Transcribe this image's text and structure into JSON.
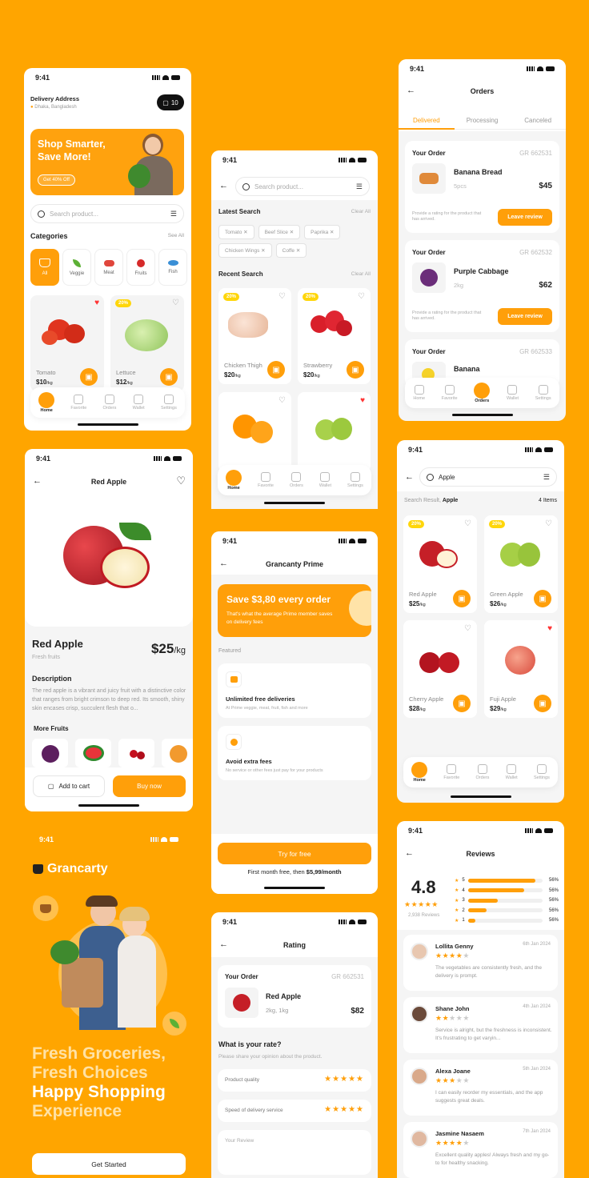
{
  "status_time": "9:41",
  "home": {
    "delivery_label": "Delivery Address",
    "delivery_location": "Dhaka, Bangladesh",
    "cart_count": "10",
    "banner_title_1": "Shop Smarter,",
    "banner_title_2": "Save More!",
    "banner_button": "Get 40% Off",
    "search_placeholder": "Search product...",
    "categories_title": "Categories",
    "see_all": "See All",
    "categories": [
      "All",
      "Veggie",
      "Meat",
      "Fruits",
      "Fish"
    ],
    "products": [
      {
        "name": "Tomato",
        "price": "$10",
        "unit": "/kg"
      },
      {
        "name": "Lettuce",
        "price": "$12",
        "unit": "/kg",
        "badge": "20%"
      }
    ]
  },
  "tabs": [
    "Home",
    "Favorite",
    "Orders",
    "Wallet",
    "Settings"
  ],
  "search_screen": {
    "placeholder": "Search product...",
    "latest_title": "Latest Search",
    "clear_all": "Clear All",
    "chips": [
      "Tomato",
      "Beef Slice",
      "Paprika",
      "Chicken Wings",
      "Coffe"
    ],
    "recent_title": "Recent Search",
    "products": [
      {
        "name": "Chicken Thigh",
        "price": "$20",
        "unit": "/kg",
        "badge": "20%"
      },
      {
        "name": "Strawberry",
        "price": "$20",
        "unit": "/kg",
        "badge": "20%"
      }
    ]
  },
  "orders": {
    "title": "Orders",
    "tabs": [
      "Delivered",
      "Processing",
      "Canceled"
    ],
    "your_order": "Your Order",
    "rating_prompt": "Provide a rating for the product that has arrived.",
    "leave_review": "Leave review",
    "items": [
      {
        "code": "GR 662531",
        "name": "Banana Bread",
        "qty": "5pcs",
        "price": "$45"
      },
      {
        "code": "GR 662532",
        "name": "Purple Cabbage",
        "qty": "2kg",
        "price": "$62"
      },
      {
        "code": "GR 662533",
        "name": "Banana"
      }
    ]
  },
  "detail": {
    "header": "Red Apple",
    "name": "Red Apple",
    "category": "Fresh fruits",
    "price": "$25",
    "unit": "/kg",
    "desc_title": "Description",
    "desc": "The red apple is a vibrant and juicy fruit with a distinctive color that ranges from bright crimson to deep red. Its smooth, shiny skin encases crisp, succulent flesh that o...",
    "more_title": "More Fruits",
    "add_to_cart": "Add to cart",
    "buy_now": "Buy now"
  },
  "prime": {
    "title": "Grancanty Prime",
    "banner_title": "Save $3,80 every order",
    "banner_sub": "That's what the average Prime member saves on delivery fees",
    "featured": "Featured",
    "features": [
      {
        "title": "Unlimited free deliveries",
        "sub": "At Prime veggie, meat, fruit, fish and more"
      },
      {
        "title": "Avoid extra fees",
        "sub": "No service or other fees just pay for your products"
      }
    ],
    "cta": "Try for free",
    "note_prefix": "First month free, then ",
    "note_price": "$5,99/month"
  },
  "results": {
    "query": "Apple",
    "result_label": "Search Result,",
    "count": "4 Items",
    "products": [
      {
        "name": "Red Apple",
        "price": "$25",
        "unit": "/kg",
        "badge": "20%"
      },
      {
        "name": "Green Apple",
        "price": "$26",
        "unit": "/kg",
        "badge": "20%"
      },
      {
        "name": "Cherry Apple",
        "price": "$28",
        "unit": "/kg"
      },
      {
        "name": "Fuji Apple",
        "price": "$29",
        "unit": "/kg"
      }
    ]
  },
  "onboarding": {
    "brand": "Grancarty",
    "line1": "Fresh Groceries,",
    "line2": "Fresh Choices",
    "line3": "Happy Shopping",
    "line4": "Experience",
    "cta": "Get Started"
  },
  "rating": {
    "title": "Rating",
    "your_order": "Your Order",
    "code": "GR 662531",
    "name": "Red Apple",
    "qty": "2kg, 1kg",
    "price": "$82",
    "question": "What is your rate?",
    "sub": "Please share your opinion about the product.",
    "criteria": [
      "Product quality",
      "Speed of delivery service"
    ],
    "review_placeholder": "Your Review"
  },
  "reviews": {
    "title": "Reviews",
    "score": "4.8",
    "count": "2,938 Reviews",
    "bars": [
      {
        "star": "5",
        "pct": "56%",
        "fill": 0.9
      },
      {
        "star": "4",
        "pct": "56%",
        "fill": 0.75
      },
      {
        "star": "3",
        "pct": "56%",
        "fill": 0.4
      },
      {
        "star": "2",
        "pct": "56%",
        "fill": 0.25
      },
      {
        "star": "1",
        "pct": "56%",
        "fill": 0.1
      }
    ],
    "items": [
      {
        "name": "Lollita Genny",
        "date": "6th Jan 2024",
        "stars": 4,
        "text": "The vegetables are consistently fresh, and the delivery is prompt."
      },
      {
        "name": "Shane John",
        "date": "4th Jan 2024",
        "stars": 2,
        "text": "Service is alright, but the freshness is inconsistent. It's frustrating to get varyin..."
      },
      {
        "name": "Alexa Joane",
        "date": "5th Jan 2024",
        "stars": 3,
        "text": "I can easily reorder my essentials, and the app suggests great deals."
      },
      {
        "name": "Jasmine Nasaem",
        "date": "7th Jan 2024",
        "stars": 4,
        "text": "Excellent quality apples! Always fresh and my go-to for healthy snacking."
      }
    ]
  }
}
